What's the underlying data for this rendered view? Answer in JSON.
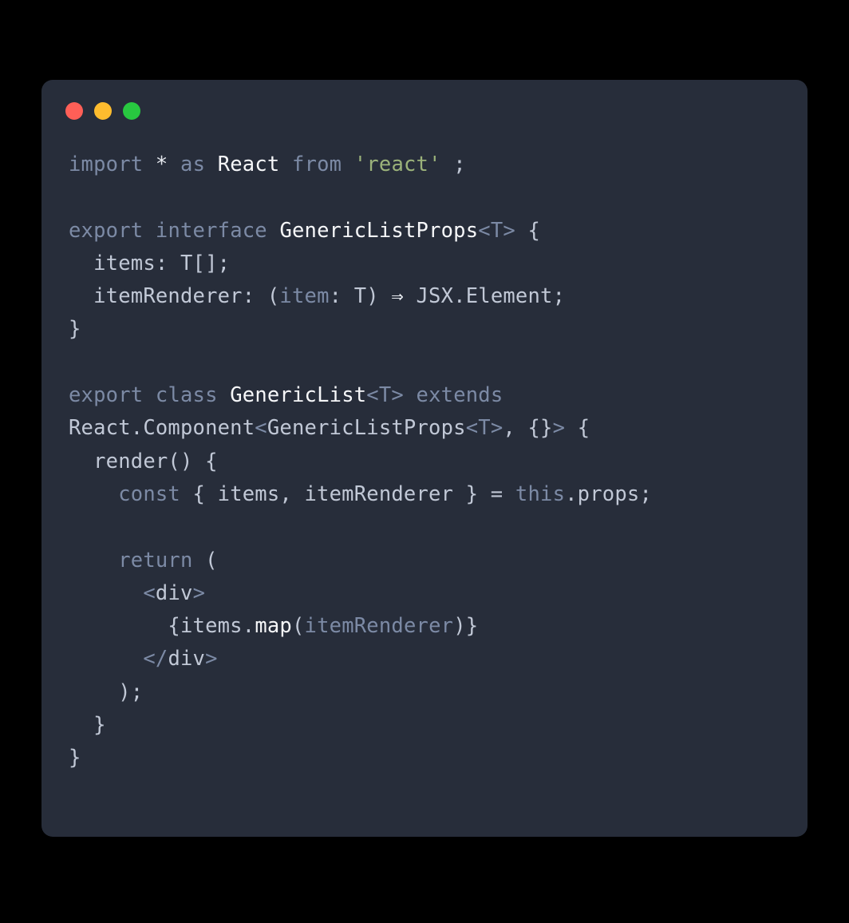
{
  "window": {
    "traffic_lights": [
      "close",
      "minimize",
      "zoom"
    ]
  },
  "code": {
    "tokens": [
      {
        "t": "import",
        "c": "kw"
      },
      {
        "t": " ",
        "c": "plain"
      },
      {
        "t": "*",
        "c": "light"
      },
      {
        "t": " ",
        "c": "plain"
      },
      {
        "t": "as",
        "c": "kw"
      },
      {
        "t": " ",
        "c": "plain"
      },
      {
        "t": "React",
        "c": "type"
      },
      {
        "t": " ",
        "c": "plain"
      },
      {
        "t": "from",
        "c": "kw"
      },
      {
        "t": " ",
        "c": "plain"
      },
      {
        "t": "'react'",
        "c": "str"
      },
      {
        "t": " ;",
        "c": "punc"
      },
      {
        "t": "\n",
        "c": "plain"
      },
      {
        "t": "\n",
        "c": "plain"
      },
      {
        "t": "export",
        "c": "kw"
      },
      {
        "t": " ",
        "c": "plain"
      },
      {
        "t": "interface",
        "c": "kw"
      },
      {
        "t": " ",
        "c": "plain"
      },
      {
        "t": "GenericListProps",
        "c": "type"
      },
      {
        "t": "<",
        "c": "generic"
      },
      {
        "t": "T",
        "c": "generic"
      },
      {
        "t": ">",
        "c": "generic"
      },
      {
        "t": " {",
        "c": "punc"
      },
      {
        "t": "\n",
        "c": "plain"
      },
      {
        "t": "  items: T[];",
        "c": "plain"
      },
      {
        "t": "\n",
        "c": "plain"
      },
      {
        "t": "  itemRenderer: (",
        "c": "plain"
      },
      {
        "t": "item",
        "c": "param"
      },
      {
        "t": ": T) ",
        "c": "plain"
      },
      {
        "t": "⇒",
        "c": "light"
      },
      {
        "t": " JSX.Element;",
        "c": "plain"
      },
      {
        "t": "\n",
        "c": "plain"
      },
      {
        "t": "}",
        "c": "punc"
      },
      {
        "t": "\n",
        "c": "plain"
      },
      {
        "t": "\n",
        "c": "plain"
      },
      {
        "t": "export",
        "c": "kw"
      },
      {
        "t": " ",
        "c": "plain"
      },
      {
        "t": "class",
        "c": "kw"
      },
      {
        "t": " ",
        "c": "plain"
      },
      {
        "t": "GenericList",
        "c": "type"
      },
      {
        "t": "<",
        "c": "generic"
      },
      {
        "t": "T",
        "c": "generic"
      },
      {
        "t": ">",
        "c": "generic"
      },
      {
        "t": " ",
        "c": "plain"
      },
      {
        "t": "extends",
        "c": "kw"
      },
      {
        "t": " ",
        "c": "plain"
      },
      {
        "t": "\n",
        "c": "plain"
      },
      {
        "t": "React.Component",
        "c": "plain"
      },
      {
        "t": "<",
        "c": "generic"
      },
      {
        "t": "GenericListProps",
        "c": "plain"
      },
      {
        "t": "<",
        "c": "generic"
      },
      {
        "t": "T",
        "c": "generic"
      },
      {
        "t": ">",
        "c": "generic"
      },
      {
        "t": ", {}",
        "c": "plain"
      },
      {
        "t": ">",
        "c": "generic"
      },
      {
        "t": " {",
        "c": "punc"
      },
      {
        "t": "\n",
        "c": "plain"
      },
      {
        "t": "  render() {",
        "c": "plain"
      },
      {
        "t": "\n",
        "c": "plain"
      },
      {
        "t": "    ",
        "c": "plain"
      },
      {
        "t": "const",
        "c": "kw"
      },
      {
        "t": " { items, itemRenderer } = ",
        "c": "plain"
      },
      {
        "t": "this",
        "c": "kw"
      },
      {
        "t": ".props;",
        "c": "plain"
      },
      {
        "t": "\n",
        "c": "plain"
      },
      {
        "t": "\n",
        "c": "plain"
      },
      {
        "t": "    ",
        "c": "plain"
      },
      {
        "t": "return",
        "c": "kw"
      },
      {
        "t": " (",
        "c": "plain"
      },
      {
        "t": "\n",
        "c": "plain"
      },
      {
        "t": "      ",
        "c": "plain"
      },
      {
        "t": "<",
        "c": "generic"
      },
      {
        "t": "div",
        "c": "plain"
      },
      {
        "t": ">",
        "c": "generic"
      },
      {
        "t": "\n",
        "c": "plain"
      },
      {
        "t": "        {items",
        "c": "plain"
      },
      {
        "t": ".",
        "c": "plain"
      },
      {
        "t": "map",
        "c": "prop"
      },
      {
        "t": "(",
        "c": "plain"
      },
      {
        "t": "itemRenderer",
        "c": "param"
      },
      {
        "t": ")}",
        "c": "plain"
      },
      {
        "t": "\n",
        "c": "plain"
      },
      {
        "t": "      ",
        "c": "plain"
      },
      {
        "t": "<",
        "c": "generic"
      },
      {
        "t": "/",
        "c": "generic"
      },
      {
        "t": "div",
        "c": "plain"
      },
      {
        "t": ">",
        "c": "generic"
      },
      {
        "t": "\n",
        "c": "plain"
      },
      {
        "t": "    );",
        "c": "plain"
      },
      {
        "t": "\n",
        "c": "plain"
      },
      {
        "t": "  }",
        "c": "plain"
      },
      {
        "t": "\n",
        "c": "plain"
      },
      {
        "t": "}",
        "c": "plain"
      }
    ],
    "plain_text": "import * as React from 'react' ;\n\nexport interface GenericListProps<T> {\n  items: T[];\n  itemRenderer: (item: T) ⇒ JSX.Element;\n}\n\nexport class GenericList<T> extends \nReact.Component<GenericListProps<T>, {}> {\n  render() {\n    const { items, itemRenderer } = this.props;\n\n    return (\n      <div>\n        {items.map(itemRenderer)}\n      </div>\n    );\n  }\n}"
  }
}
